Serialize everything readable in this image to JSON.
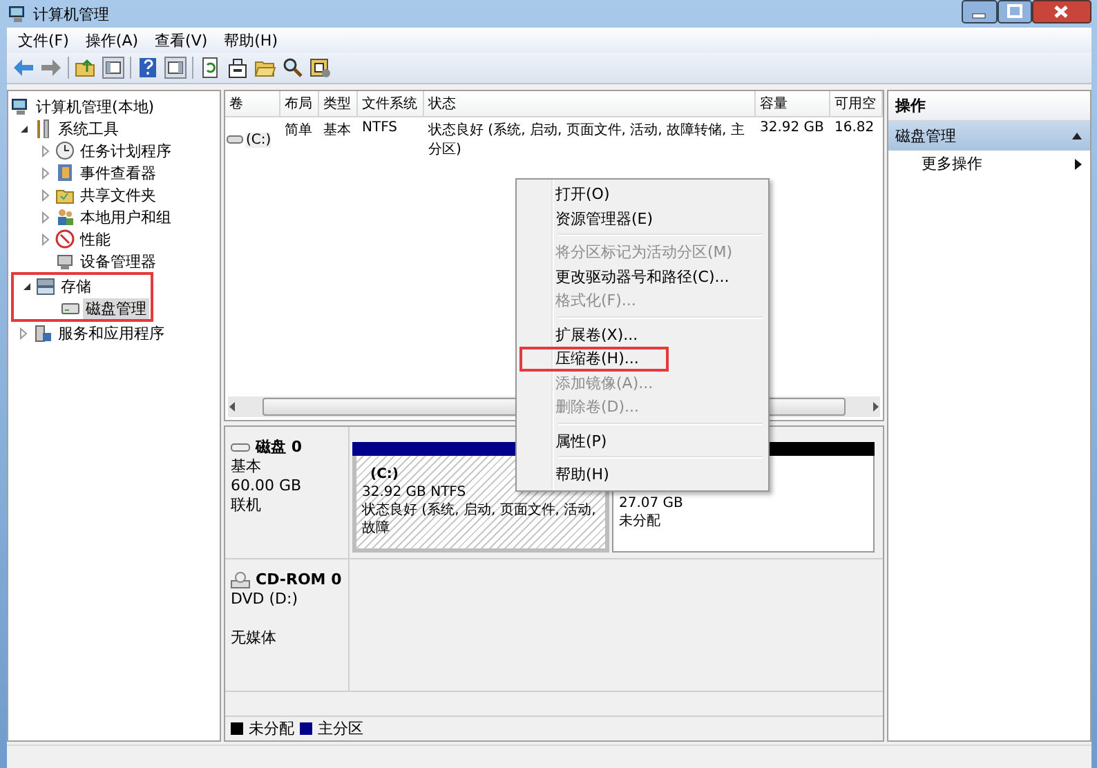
{
  "window": {
    "title": "计算机管理"
  },
  "menu": [
    "文件(F)",
    "操作(A)",
    "查看(V)",
    "帮助(H)"
  ],
  "tree": [
    {
      "label": "计算机管理(本地)",
      "selected": false,
      "children": [
        {
          "label": "系统工具",
          "selected": false,
          "expanded": true,
          "children": [
            {
              "label": "任务计划程序",
              "selected": false,
              "expanded": false
            },
            {
              "label": "事件查看器",
              "selected": false,
              "expanded": false
            },
            {
              "label": "共享文件夹",
              "selected": false,
              "expanded": false
            },
            {
              "label": "本地用户和组",
              "selected": false,
              "expanded": false
            },
            {
              "label": "性能",
              "selected": false,
              "expanded": false
            },
            {
              "label": "设备管理器",
              "selected": false
            }
          ]
        },
        {
          "label": "存储",
          "selected": false,
          "expanded": true,
          "annotated": true,
          "children": [
            {
              "label": "磁盘管理",
              "selected": true
            }
          ]
        },
        {
          "label": "服务和应用程序",
          "selected": false,
          "expanded": false
        }
      ]
    }
  ],
  "volumes": {
    "columns": [
      "卷",
      "布局",
      "类型",
      "文件系统",
      "状态",
      "容量",
      "可用空"
    ],
    "rows": [
      {
        "cells": [
          "(C:)",
          "简单",
          "基本",
          "NTFS",
          "状态良好 (系统, 启动, 页面文件, 活动, 故障转储, 主分区)",
          "32.92 GB",
          "16.82"
        ]
      }
    ]
  },
  "disks": [
    {
      "kind": "disk",
      "name": "磁盘 0",
      "lines": [
        "基本",
        "60.00 GB",
        "联机"
      ],
      "partitions": [
        {
          "kind": "primary",
          "label": "(C:)",
          "size": "32.92 GB NTFS",
          "status": "状态良好 (系统, 启动, 页面文件, 活动, 故障",
          "selected": true
        },
        {
          "kind": "unallocated",
          "size": "27.07 GB",
          "status": "未分配",
          "selected": false
        }
      ]
    },
    {
      "kind": "cdrom",
      "name": "CD-ROM 0",
      "lines": [
        "DVD (D:)",
        "无媒体"
      ]
    }
  ],
  "legend": [
    {
      "kind": "unallocated",
      "label": "未分配",
      "color": "#000000"
    },
    {
      "kind": "primary",
      "label": "主分区",
      "color": "#00008b"
    }
  ],
  "actions": {
    "header": "操作",
    "sections": [
      {
        "title": "磁盘管理",
        "expanded": true,
        "items": [
          {
            "label": "更多操作",
            "submenu": true
          }
        ]
      }
    ]
  },
  "context_menu": {
    "groups": [
      [
        {
          "label": "打开(O)",
          "disabled": false
        },
        {
          "label": "资源管理器(E)",
          "disabled": false
        }
      ],
      [
        {
          "label": "将分区标记为活动分区(M)",
          "disabled": true
        },
        {
          "label": "更改驱动器号和路径(C)...",
          "disabled": false
        },
        {
          "label": "格式化(F)...",
          "disabled": true
        }
      ],
      [
        {
          "label": "扩展卷(X)...",
          "disabled": false
        },
        {
          "label": "压缩卷(H)...",
          "disabled": false,
          "annotated": true
        },
        {
          "label": "添加镜像(A)...",
          "disabled": true
        },
        {
          "label": "删除卷(D)...",
          "disabled": true
        }
      ],
      [
        {
          "label": "属性(P)",
          "disabled": false
        }
      ],
      [
        {
          "label": "帮助(H)",
          "disabled": false
        }
      ]
    ]
  }
}
